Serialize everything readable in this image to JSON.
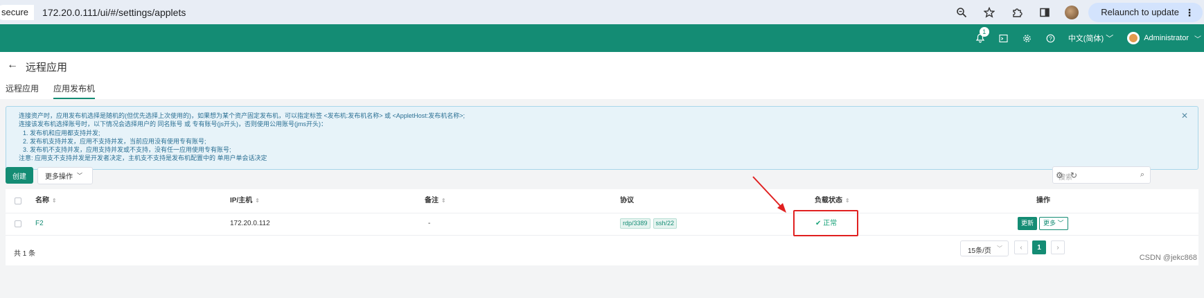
{
  "browser": {
    "secure_label": "secure",
    "url": "172.20.0.111/ui/#/settings/applets",
    "relaunch_label": "Relaunch to update",
    "icons": [
      "zoom-icon",
      "star-icon",
      "extensions-icon",
      "sidebar-icon",
      "profile-avatar",
      "menu-icon"
    ]
  },
  "header": {
    "notification_count": "1",
    "language": "中文(简体)",
    "user": "Administrator",
    "brand_color": "#148c74"
  },
  "page": {
    "title": "远程应用",
    "tabs": [
      {
        "label": "远程应用",
        "active": false
      },
      {
        "label": "应用发布机",
        "active": true
      }
    ]
  },
  "info": {
    "lines": [
      "连接资产时，应用发布机选择是随机的(但优先选择上次使用的)，如果想为某个资产固定发布机，可以指定标签 <发布机:发布机名称> 或 <AppletHost:发布机名称>;",
      "连接该发布机选择账号时，以下情况会选择用户的 同名账号 或 专有账号(js开头)，否则使用公用账号(jms开头)：",
      "1. 发布机和应用都支持并发;",
      "2. 发布机支持并发，应用不支持并发，当前应用没有使用专有账号;",
      "3. 发布机不支持并发，应用支持并发或不支持，没有任一应用使用专有账号;",
      "注意: 应用支不支持并发是开发者决定，主机支不支持是发布机配置中的 单用户单会话决定"
    ]
  },
  "toolbar": {
    "create_label": "创建",
    "more_ops_label": "更多操作",
    "search_placeholder": "搜索"
  },
  "table": {
    "columns": [
      "名称",
      "IP/主机",
      "备注",
      "协议",
      "负载状态",
      "操作"
    ],
    "rows": [
      {
        "name": "F2",
        "ip": "172.20.0.112",
        "comment": "-",
        "protocols": [
          "rdp/3389",
          "ssh/22"
        ],
        "status": "正常",
        "actions": {
          "update": "更新",
          "more": "更多"
        }
      }
    ]
  },
  "pagination": {
    "total": "共 1 条",
    "page_size": "15条/页",
    "current_page": "1"
  },
  "watermark": "CSDN @jekc868"
}
